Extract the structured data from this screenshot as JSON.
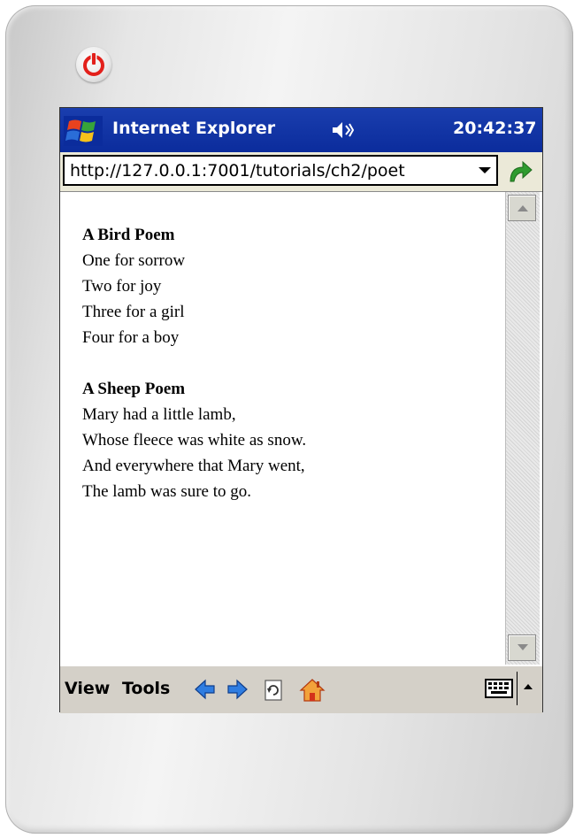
{
  "titlebar": {
    "app_title": "Internet Explorer",
    "clock": "20:42:37",
    "start_icon": "windows-flag-icon",
    "volume_icon": "speaker-icon"
  },
  "addressbar": {
    "url": "http://127.0.0.1:7001/tutorials/ch2/poet",
    "go_icon": "green-go-arrow-icon"
  },
  "document": {
    "poems": [
      {
        "title": "A Bird Poem",
        "lines": [
          "One for sorrow",
          "Two for joy",
          "Three for a girl",
          "Four for a boy"
        ]
      },
      {
        "title": "A Sheep Poem",
        "lines": [
          "Mary had a little lamb,",
          "Whose fleece was white as snow.",
          "And everywhere that Mary went,",
          "The lamb was sure to go."
        ]
      }
    ]
  },
  "menubar": {
    "view_label": "View",
    "tools_label": "Tools",
    "icons": [
      "back-icon",
      "forward-icon",
      "refresh-icon",
      "home-icon",
      "keyboard-icon",
      "sip-arrow-icon"
    ]
  },
  "colors": {
    "titlebar": "#0b2c9c",
    "menubar": "#d4d0c8",
    "address_bg": "#ebe9d8",
    "power_red": "#e3201b"
  }
}
